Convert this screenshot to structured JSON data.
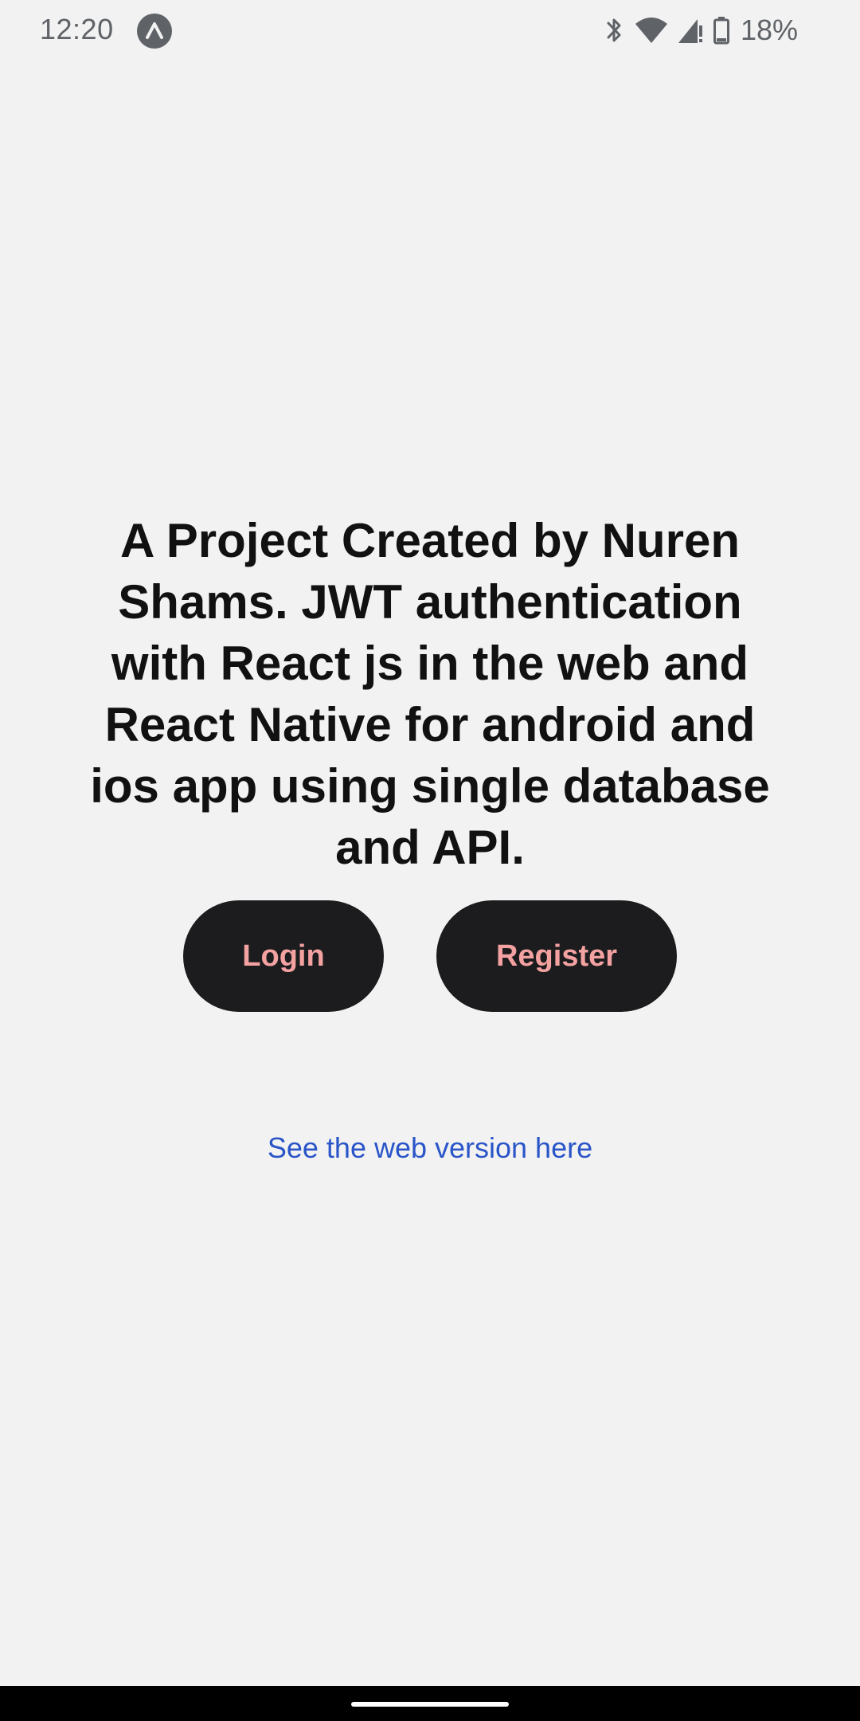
{
  "status_bar": {
    "time": "12:20",
    "badge_icon": "expo-app-icon",
    "icons": [
      "bluetooth-icon",
      "wifi-icon",
      "cell-signal-icon",
      "battery-icon"
    ],
    "battery_percent": "18%"
  },
  "main": {
    "headline": "A Project Created by Nuren Shams. JWT authentication with React js in the web and React Native for android and ios app using single database and API.",
    "buttons": {
      "login_label": "Login",
      "register_label": "Register"
    },
    "web_link_label": "See the web version here"
  },
  "colors": {
    "background": "#f2f2f2",
    "button_bg": "#1c1c1e",
    "button_text": "#f4a1a1",
    "link": "#2a55c9",
    "headline": "#111111"
  }
}
